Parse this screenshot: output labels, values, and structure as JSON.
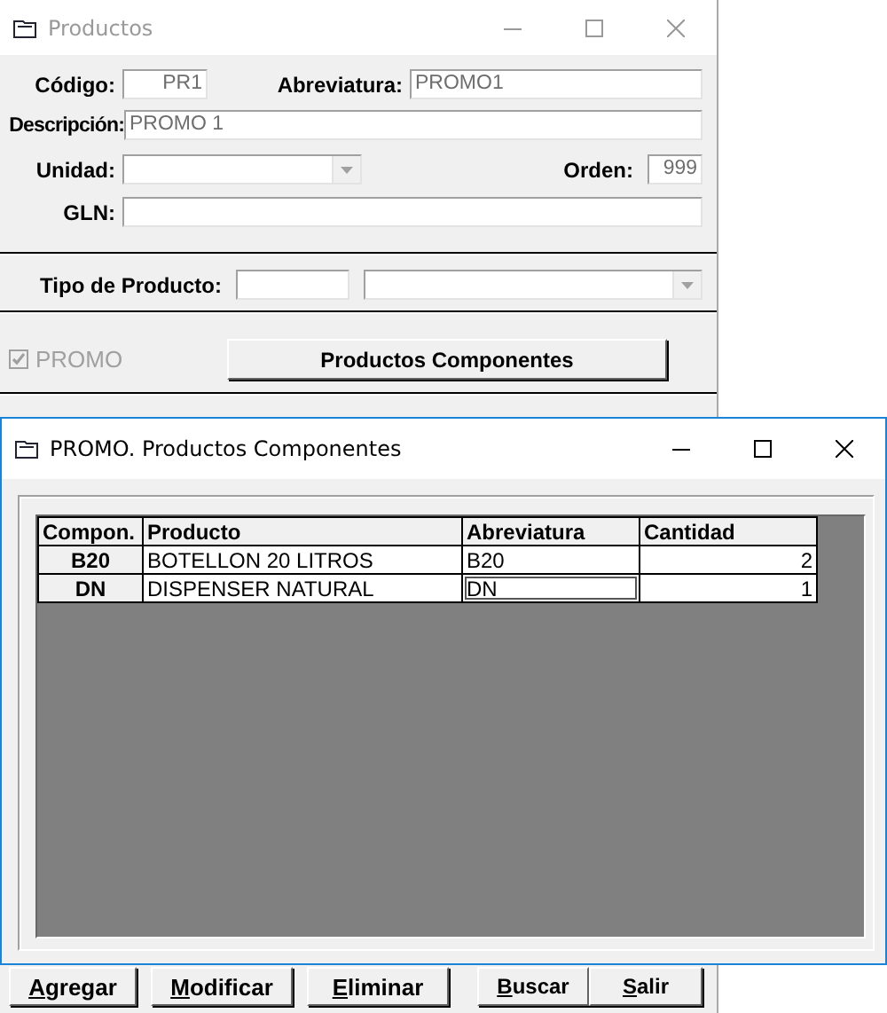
{
  "main_window": {
    "title": "Productos",
    "active": false,
    "fields": {
      "codigo_label": "Código:",
      "codigo": "PR1",
      "abreviatura_label": "Abreviatura:",
      "abreviatura": "PROMO1",
      "descripcion_label": "Descripción:",
      "descripcion": "PROMO 1",
      "unidad_label": "Unidad:",
      "orden_label": "Orden:",
      "orden": "999",
      "gln_label": "GLN:",
      "tipo_label": "Tipo de Producto:"
    },
    "promo": {
      "label": "PROMO",
      "checked": true,
      "disabled": true
    },
    "components_button": "Productos Componentes",
    "buttons": [
      {
        "label": "Agregar",
        "access_key_underlined": true
      },
      {
        "label": "Modificar",
        "access_key_underlined": true
      },
      {
        "label": "Eliminar",
        "access_key_underlined": true
      },
      {
        "label": "Buscar",
        "access_key_underlined": true
      },
      {
        "label": "Salir",
        "access_key_underlined": true
      }
    ]
  },
  "dialog": {
    "title": "PROMO. Productos Componentes",
    "active": true,
    "table": {
      "columns": [
        "Compon.",
        "Producto",
        "Abreviatura",
        "Cantidad"
      ],
      "rows": [
        {
          "compon": "B20",
          "producto": "BOTELLON 20 LITROS",
          "abreviatura": "B20",
          "cantidad": "2",
          "focused": false
        },
        {
          "compon": "DN",
          "producto": "DISPENSER NATURAL",
          "abreviatura": "DN",
          "cantidad": "1",
          "focused": true
        }
      ]
    }
  }
}
